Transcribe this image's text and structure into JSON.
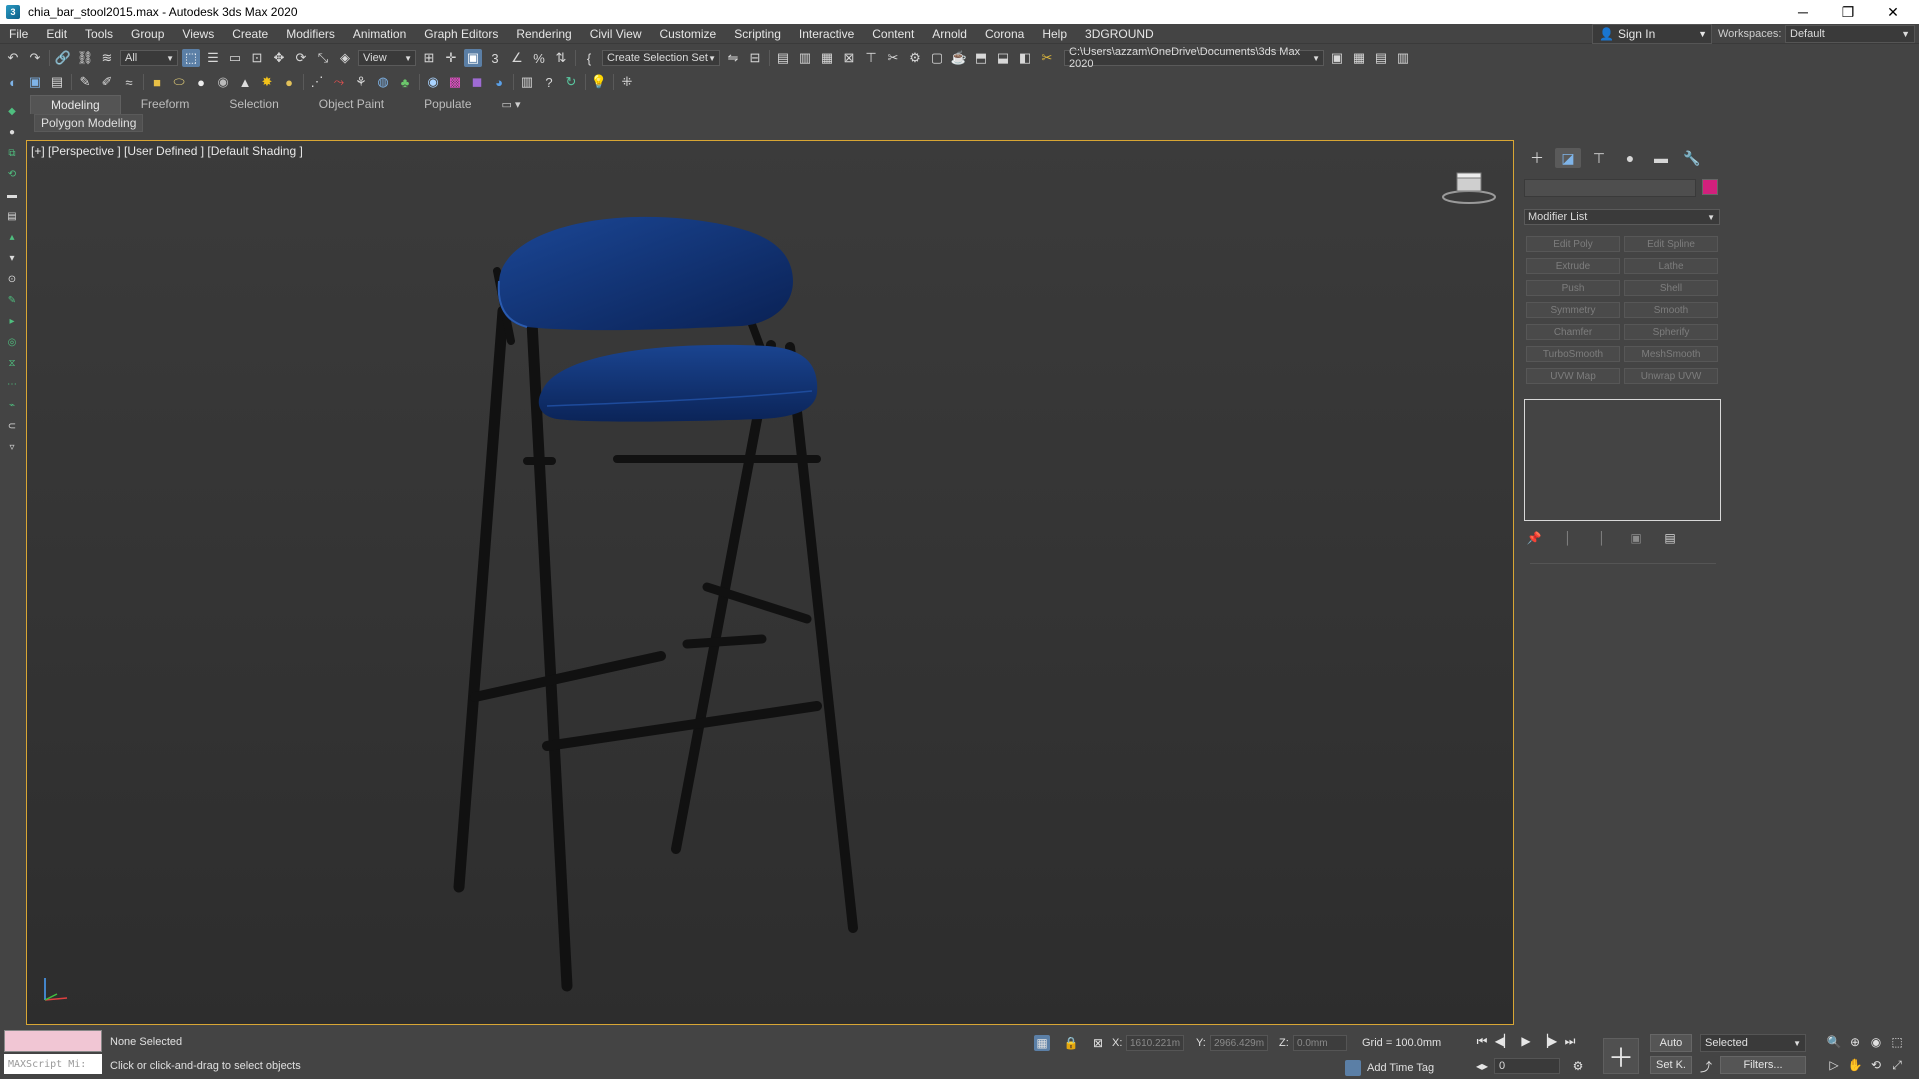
{
  "window": {
    "title": "chia_bar_stool2015.max - Autodesk 3ds Max 2020",
    "minimize": "─",
    "maximize": "❐",
    "close": "✕"
  },
  "menu": [
    "File",
    "Edit",
    "Tools",
    "Group",
    "Views",
    "Create",
    "Modifiers",
    "Animation",
    "Graph Editors",
    "Rendering",
    "Civil View",
    "Customize",
    "Scripting",
    "Interactive",
    "Content",
    "Arnold",
    "Corona",
    "Help",
    "3DGROUND"
  ],
  "account": {
    "sign_in": "Sign In",
    "workspaces_label": "Workspaces:",
    "workspace_value": "Default"
  },
  "toolbar1": {
    "selection_filter": "All",
    "ref_coord": "View",
    "named_selection": "Create Selection Set",
    "project_path": "C:\\Users\\azzam\\OneDrive\\Documents\\3ds Max 2020"
  },
  "ribbon": {
    "tabs": [
      "Modeling",
      "Freeform",
      "Selection",
      "Object Paint",
      "Populate"
    ],
    "active_tab": "Modeling",
    "sub_panel": "Polygon Modeling"
  },
  "viewport": {
    "label": "[+] [Perspective ] [User Defined ] [Default Shading ]",
    "seat_color": "#0e2f6e",
    "frame_color": "#111111"
  },
  "command_panel": {
    "tabs": [
      "create-icon",
      "modify-icon",
      "hierarchy-icon",
      "motion-icon",
      "display-icon",
      "utilities-icon"
    ],
    "object_color": "#d2207d",
    "modifier_list": "Modifier List",
    "modifier_buttons": [
      "Edit Poly",
      "Edit Spline",
      "Extrude",
      "Lathe",
      "Push",
      "Shell",
      "Symmetry",
      "Smooth",
      "Chamfer",
      "Spherify",
      "TurboSmooth",
      "MeshSmooth",
      "UVW Map",
      "Unwrap UVW"
    ]
  },
  "status": {
    "maxscript_label": "MAXScript Mi:",
    "selection": "None Selected",
    "prompt": "Click or click-and-drag to select objects",
    "x_label": "X:",
    "x_value": "1610.221m",
    "y_label": "Y:",
    "y_value": "2966.429m",
    "z_label": "Z:",
    "z_value": "0.0mm",
    "grid": "Grid = 100.0mm",
    "add_time_tag": "Add Time Tag",
    "frame": "0",
    "auto": "Auto",
    "set_key": "Set K.",
    "key_filter": "Selected",
    "filters": "Filters..."
  }
}
